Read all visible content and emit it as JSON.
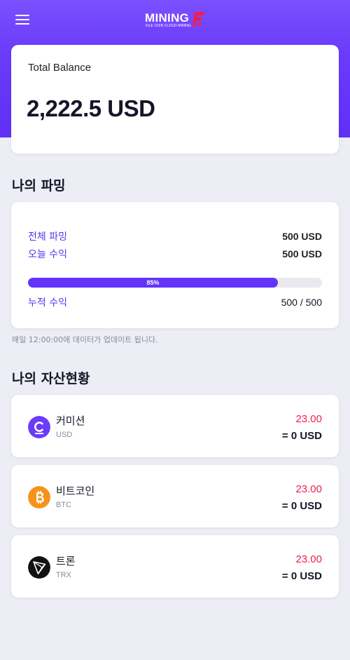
{
  "header": {
    "menu_icon": "hamburger-menu-icon",
    "logo_word": "MINING",
    "logo_sub": "FILE COIN CLOUD MINING",
    "logo_mark_color": "#ee1f4f"
  },
  "balance": {
    "label": "Total Balance",
    "value": "2,222.5 USD"
  },
  "mining": {
    "title": "나의 파밍",
    "total_label": "전체 파밍",
    "total_value": "500 USD",
    "today_label": "오늘 수익",
    "today_value": "500 USD",
    "progress_text": "85%",
    "progress_fraction": 0.85,
    "cumulative_label": "누적 수익",
    "cumulative_value": "500 / 500",
    "note": "매일 12:00:00에 데이터가 업데이트 됩니다."
  },
  "assets": {
    "title": "나의 자산현황",
    "items": [
      {
        "name": "커미션",
        "symbol": "USD",
        "amount": "23.00",
        "converted": "= 0 USD",
        "icon": "commission-coin-icon",
        "icon_color": "#6a3bfa"
      },
      {
        "name": "비트코인",
        "symbol": "BTC",
        "amount": "23.00",
        "converted": "= 0 USD",
        "icon": "bitcoin-icon",
        "icon_color": "#f7931a"
      },
      {
        "name": "트론",
        "symbol": "TRX",
        "amount": "23.00",
        "converted": "= 0 USD",
        "icon": "tron-icon",
        "icon_color": "#111111"
      }
    ]
  },
  "colors": {
    "accent": "#6233fa",
    "label_purple": "#5236e8",
    "amount_red": "#ee1f4f"
  }
}
